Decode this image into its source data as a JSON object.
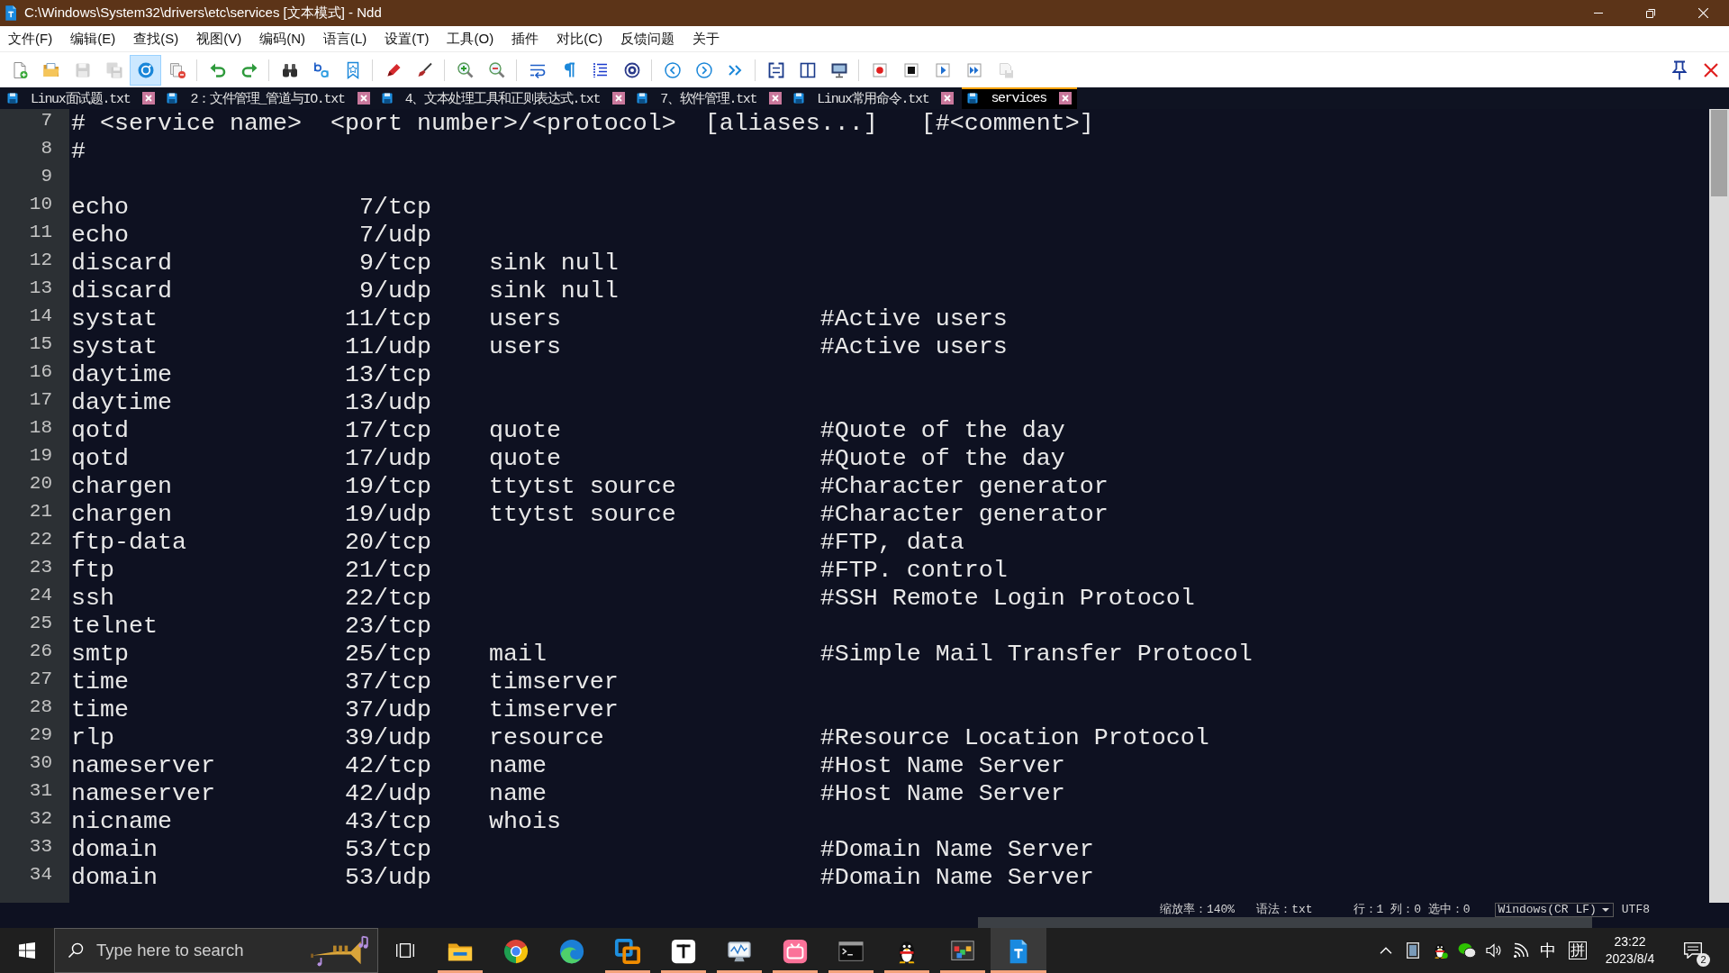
{
  "window": {
    "title": "C:\\Windows\\System32\\drivers\\etc\\services [文本模式] - Ndd"
  },
  "menu": [
    "文件(F)",
    "编辑(E)",
    "查找(S)",
    "视图(V)",
    "编码(N)",
    "语言(L)",
    "设置(T)",
    "工具(O)",
    "插件",
    "对比(C)",
    "反馈问题",
    "关于"
  ],
  "toolbar": {
    "groups": [
      [
        {
          "kind": "new",
          "on": false,
          "disabled": false
        },
        {
          "kind": "open",
          "on": false,
          "disabled": false
        },
        {
          "kind": "save",
          "on": false,
          "disabled": true
        },
        {
          "kind": "saveall",
          "on": false,
          "disabled": true
        },
        {
          "kind": "monitor",
          "on": true,
          "disabled": false
        },
        {
          "kind": "closeall",
          "on": false,
          "disabled": false
        }
      ],
      [
        {
          "kind": "undo",
          "on": false,
          "disabled": false
        },
        {
          "kind": "redo",
          "on": false,
          "disabled": false
        }
      ],
      [
        {
          "kind": "find",
          "on": false,
          "disabled": false
        },
        {
          "kind": "replace",
          "on": false,
          "disabled": false
        },
        {
          "kind": "bookmark",
          "on": false,
          "disabled": false
        }
      ],
      [
        {
          "kind": "mark",
          "on": false,
          "disabled": false
        },
        {
          "kind": "clear",
          "on": false,
          "disabled": false
        }
      ],
      [
        {
          "kind": "zoomin",
          "on": false,
          "disabled": false
        },
        {
          "kind": "zoomout",
          "on": false,
          "disabled": false
        }
      ],
      [
        {
          "kind": "wrap",
          "on": false,
          "disabled": false
        },
        {
          "kind": "symbols",
          "on": false,
          "disabled": false
        },
        {
          "kind": "indent",
          "on": false,
          "disabled": false
        },
        {
          "kind": "target",
          "on": false,
          "disabled": false
        }
      ],
      [
        {
          "kind": "prev",
          "on": false,
          "disabled": false
        },
        {
          "kind": "next",
          "on": false,
          "disabled": false
        },
        {
          "kind": "goto",
          "on": false,
          "disabled": false
        }
      ],
      [
        {
          "kind": "compare",
          "on": false,
          "disabled": false
        },
        {
          "kind": "split",
          "on": false,
          "disabled": false
        },
        {
          "kind": "screen",
          "on": false,
          "disabled": false
        }
      ],
      [
        {
          "kind": "record",
          "on": false,
          "disabled": false
        },
        {
          "kind": "stop",
          "on": false,
          "disabled": false
        },
        {
          "kind": "play",
          "on": false,
          "disabled": false
        },
        {
          "kind": "playall",
          "on": false,
          "disabled": false
        },
        {
          "kind": "macrosave",
          "on": false,
          "disabled": true
        }
      ]
    ]
  },
  "tabs": [
    {
      "label": "Linux面试题.txt",
      "selected": false
    },
    {
      "label": "2：文件管理_管道与IO.txt",
      "selected": false
    },
    {
      "label": "4、文本处理工具和正则表达式.txt",
      "selected": false
    },
    {
      "label": "7、软件管理.txt",
      "selected": false
    },
    {
      "label": "Linux常用命令.txt",
      "selected": false
    },
    {
      "label": "services",
      "selected": true
    }
  ],
  "editor": {
    "lines": [
      {
        "number": "7",
        "kind": "comment",
        "text": "# <service name>  <port number>/<protocol>  [aliases...]   [#<comment>]"
      },
      {
        "number": "8",
        "kind": "comment",
        "text": "#"
      },
      {
        "number": "9",
        "kind": "blank"
      },
      {
        "number": "10",
        "kind": "entry",
        "service": "echo",
        "port": "7/tcp"
      },
      {
        "number": "11",
        "kind": "entry",
        "service": "echo",
        "port": "7/udp"
      },
      {
        "number": "12",
        "kind": "entry",
        "service": "discard",
        "port": "9/tcp",
        "aliases": "sink null"
      },
      {
        "number": "13",
        "kind": "entry",
        "service": "discard",
        "port": "9/udp",
        "aliases": "sink null"
      },
      {
        "number": "14",
        "kind": "entry",
        "service": "systat",
        "port": "11/tcp",
        "aliases": "users",
        "comment": "#Active users"
      },
      {
        "number": "15",
        "kind": "entry",
        "service": "systat",
        "port": "11/udp",
        "aliases": "users",
        "comment": "#Active users"
      },
      {
        "number": "16",
        "kind": "entry",
        "service": "daytime",
        "port": "13/tcp"
      },
      {
        "number": "17",
        "kind": "entry",
        "service": "daytime",
        "port": "13/udp"
      },
      {
        "number": "18",
        "kind": "entry",
        "service": "qotd",
        "port": "17/tcp",
        "aliases": "quote",
        "comment": "#Quote of the day"
      },
      {
        "number": "19",
        "kind": "entry",
        "service": "qotd",
        "port": "17/udp",
        "aliases": "quote",
        "comment": "#Quote of the day"
      },
      {
        "number": "20",
        "kind": "entry",
        "service": "chargen",
        "port": "19/tcp",
        "aliases": "ttytst source",
        "comment": "#Character generator"
      },
      {
        "number": "21",
        "kind": "entry",
        "service": "chargen",
        "port": "19/udp",
        "aliases": "ttytst source",
        "comment": "#Character generator"
      },
      {
        "number": "22",
        "kind": "entry",
        "service": "ftp-data",
        "port": "20/tcp",
        "comment": "#FTP, data"
      },
      {
        "number": "23",
        "kind": "entry",
        "service": "ftp",
        "port": "21/tcp",
        "comment": "#FTP. control"
      },
      {
        "number": "24",
        "kind": "entry",
        "service": "ssh",
        "port": "22/tcp",
        "comment": "#SSH Remote Login Protocol"
      },
      {
        "number": "25",
        "kind": "entry",
        "service": "telnet",
        "port": "23/tcp"
      },
      {
        "number": "26",
        "kind": "entry",
        "service": "smtp",
        "port": "25/tcp",
        "aliases": "mail",
        "comment": "#Simple Mail Transfer Protocol"
      },
      {
        "number": "27",
        "kind": "entry",
        "service": "time",
        "port": "37/tcp",
        "aliases": "timserver"
      },
      {
        "number": "28",
        "kind": "entry",
        "service": "time",
        "port": "37/udp",
        "aliases": "timserver"
      },
      {
        "number": "29",
        "kind": "entry",
        "service": "rlp",
        "port": "39/udp",
        "aliases": "resource",
        "comment": "#Resource Location Protocol"
      },
      {
        "number": "30",
        "kind": "entry",
        "service": "nameserver",
        "port": "42/tcp",
        "aliases": "name",
        "comment": "#Host Name Server"
      },
      {
        "number": "31",
        "kind": "entry",
        "service": "nameserver",
        "port": "42/udp",
        "aliases": "name",
        "comment": "#Host Name Server"
      },
      {
        "number": "32",
        "kind": "entry",
        "service": "nicname",
        "port": "43/tcp",
        "aliases": "whois"
      },
      {
        "number": "33",
        "kind": "entry",
        "service": "domain",
        "port": "53/tcp",
        "comment": "#Domain Name Server"
      },
      {
        "number": "34",
        "kind": "entry",
        "service": "domain",
        "port": "53/udp",
        "comment": "#Domain Name Server"
      }
    ]
  },
  "status_bar": {
    "zoom": "缩放率：140%",
    "syntax": "语法：txt",
    "position": "行：1 列：0 选中：0",
    "line_ending": "Windows(CR LF)",
    "encoding": "UTF8"
  },
  "taskbar": {
    "search": {
      "placeholder": "Type here to search"
    },
    "apps": [
      {
        "kind": "folder",
        "running": true,
        "active": false
      },
      {
        "kind": "ringbrowser",
        "running": false,
        "active": false
      },
      {
        "kind": "wavebrowser",
        "running": false,
        "active": false
      },
      {
        "kind": "squares",
        "running": true,
        "active": false
      },
      {
        "kind": "lettert",
        "running": true,
        "active": false
      },
      {
        "kind": "monitor",
        "running": true,
        "active": false
      },
      {
        "kind": "tv",
        "running": true,
        "active": false
      },
      {
        "kind": "terminal",
        "running": true,
        "active": false
      },
      {
        "kind": "penguin",
        "running": true,
        "active": false
      },
      {
        "kind": "blocks",
        "running": true,
        "active": false
      },
      {
        "kind": "notepad",
        "running": true,
        "active": true
      }
    ],
    "tray": {
      "ime": "中",
      "input_mode": "拼",
      "time": "23:22",
      "date": "2023/8/4",
      "notifications": "2"
    }
  }
}
